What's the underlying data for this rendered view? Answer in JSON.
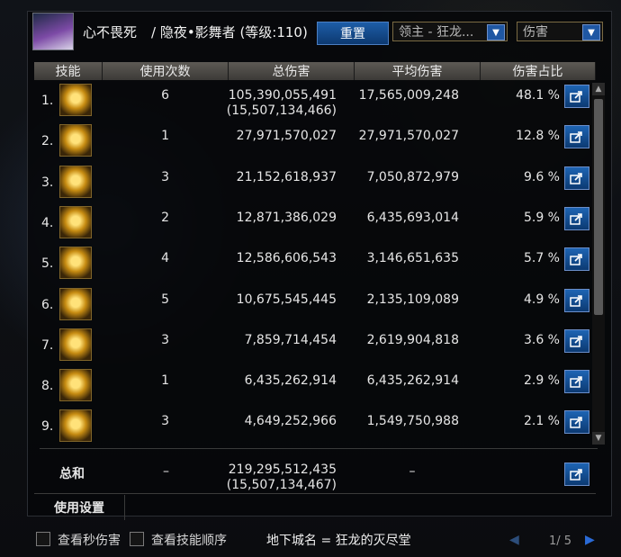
{
  "header": {
    "char_name": "心不畏死",
    "char_class": "/ 隐夜•影舞者 (等级:110)",
    "reset_label": "重置",
    "dropdown_target": "领主 - 狂龙...",
    "dropdown_metric": "伤害"
  },
  "table": {
    "headers": [
      "技能",
      "使用次数",
      "总伤害",
      "平均伤害",
      "伤害占比"
    ],
    "rows": [
      {
        "idx": "1.",
        "count": "6",
        "total": "105,390,055,491",
        "total_sub": "(15,507,134,466)",
        "avg": "17,565,009,248",
        "pct": "48.1 %"
      },
      {
        "idx": "2.",
        "count": "1",
        "total": "27,971,570,027",
        "total_sub": "",
        "avg": "27,971,570,027",
        "pct": "12.8 %"
      },
      {
        "idx": "3.",
        "count": "3",
        "total": "21,152,618,937",
        "total_sub": "",
        "avg": "7,050,872,979",
        "pct": "9.6 %"
      },
      {
        "idx": "4.",
        "count": "2",
        "total": "12,871,386,029",
        "total_sub": "",
        "avg": "6,435,693,014",
        "pct": "5.9 %"
      },
      {
        "idx": "5.",
        "count": "4",
        "total": "12,586,606,543",
        "total_sub": "",
        "avg": "3,146,651,635",
        "pct": "5.7 %"
      },
      {
        "idx": "6.",
        "count": "5",
        "total": "10,675,545,445",
        "total_sub": "",
        "avg": "2,135,109,089",
        "pct": "4.9 %"
      },
      {
        "idx": "7.",
        "count": "3",
        "total": "7,859,714,454",
        "total_sub": "",
        "avg": "2,619,904,818",
        "pct": "3.6 %"
      },
      {
        "idx": "8.",
        "count": "1",
        "total": "6,435,262,914",
        "total_sub": "",
        "avg": "6,435,262,914",
        "pct": "2.9 %"
      },
      {
        "idx": "9.",
        "count": "3",
        "total": "4,649,252,966",
        "total_sub": "",
        "avg": "1,549,750,988",
        "pct": "2.1 %"
      }
    ]
  },
  "summary": {
    "label": "总和",
    "count": "–",
    "total": "219,295,512,435",
    "total_sub": "(15,507,134,467)",
    "avg": "–"
  },
  "footer": {
    "usage_settings": "使用设置",
    "checkbox_dps": "查看秒伤害",
    "checkbox_order": "查看技能顺序",
    "dungeon": "地下城名 = 狂龙的灭尽堂",
    "page": "1/ 5"
  },
  "icons": {
    "share": "share-icon",
    "dropdown": "chevron-down-icon",
    "prev": "triangle-left-icon",
    "next": "triangle-right-icon"
  },
  "colors": {
    "accent_blue": "#1f57a3",
    "icon_gold": "#c78c12"
  }
}
